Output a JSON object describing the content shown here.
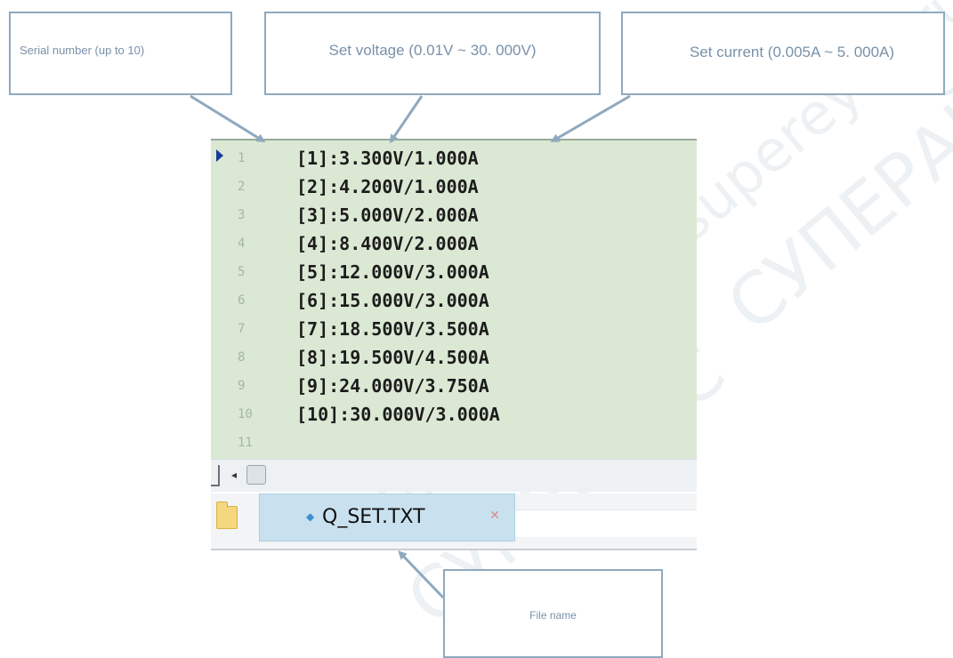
{
  "callouts": {
    "serial": "Serial number (up to 10)",
    "voltage": "Set voltage (0.01V ~ 30. 000V)",
    "current": "Set current (0.005A ~ 5. 000A)",
    "file": "File name"
  },
  "editor": {
    "line_numbers": [
      "1",
      "2",
      "3",
      "4",
      "5",
      "6",
      "7",
      "8",
      "9",
      "10",
      "11"
    ],
    "lines": [
      "[1]:3.300V/1.000A",
      "[2]:4.200V/1.000A",
      "[3]:5.000V/2.000A",
      "[4]:8.400V/2.000A",
      "[5]:12.000V/3.000A",
      "[6]:15.000V/3.000A",
      "[7]:18.500V/3.500A",
      "[8]:19.500V/4.500A",
      "[9]:24.000V/3.750A",
      "[10]:30.000V/3.000A"
    ]
  },
  "tab": {
    "filename": "Q_SET.TXT"
  },
  "icons": {
    "cursor": "current-line-arrow-icon",
    "folder": "folder-icon",
    "close": "close-tab-icon",
    "scroll_left": "scroll-left-arrow-icon"
  },
  "colors": {
    "editor_bg": "#dbe8d4",
    "callout_border": "#8fa9bf",
    "tab_active_bg": "#c9e1ef"
  },
  "watermark": [
    "supereyes.ru",
    "СУПЕРАЙС"
  ]
}
